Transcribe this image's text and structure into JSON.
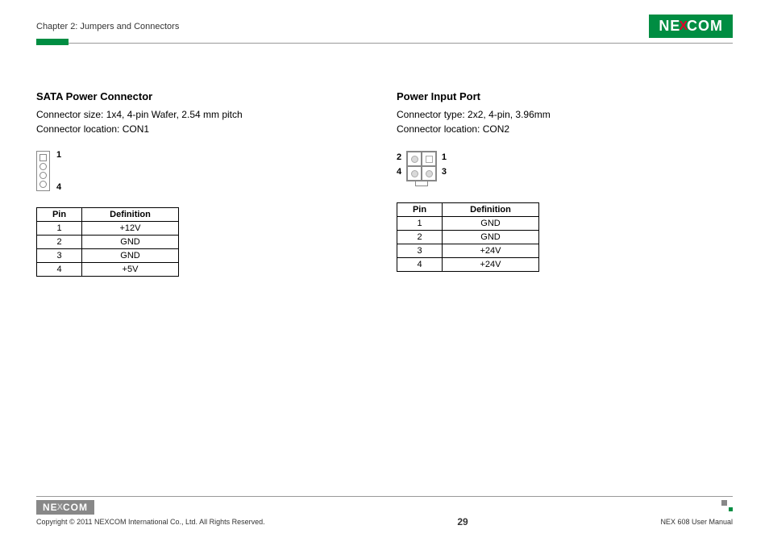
{
  "header": {
    "chapter": "Chapter 2: Jumpers and Connectors",
    "logo_left": "NE",
    "logo_x": "X",
    "logo_right": "COM"
  },
  "left": {
    "title": "SATA Power Connector",
    "desc_line1": "Connector size: 1x4, 4-pin Wafer, 2.54 mm pitch",
    "desc_line2": "Connector location: CON1",
    "label_top": "1",
    "label_bot": "4",
    "th_pin": "Pin",
    "th_def": "Definition",
    "rows": [
      {
        "pin": "1",
        "def": "+12V"
      },
      {
        "pin": "2",
        "def": "GND"
      },
      {
        "pin": "3",
        "def": "GND"
      },
      {
        "pin": "4",
        "def": "+5V"
      }
    ]
  },
  "right": {
    "title": "Power Input Port",
    "desc_line1": "Connector type: 2x2, 4-pin, 3.96mm",
    "desc_line2": "Connector location: CON2",
    "lbl1": "1",
    "lbl2": "2",
    "lbl3": "3",
    "lbl4": "4",
    "th_pin": "Pin",
    "th_def": "Definition",
    "rows": [
      {
        "pin": "1",
        "def": "GND"
      },
      {
        "pin": "2",
        "def": "GND"
      },
      {
        "pin": "3",
        "def": "+24V"
      },
      {
        "pin": "4",
        "def": "+24V"
      }
    ]
  },
  "footer": {
    "copyright": "Copyright © 2011 NEXCOM International Co., Ltd. All Rights Reserved.",
    "page": "29",
    "manual": "NEX 608 User Manual"
  }
}
